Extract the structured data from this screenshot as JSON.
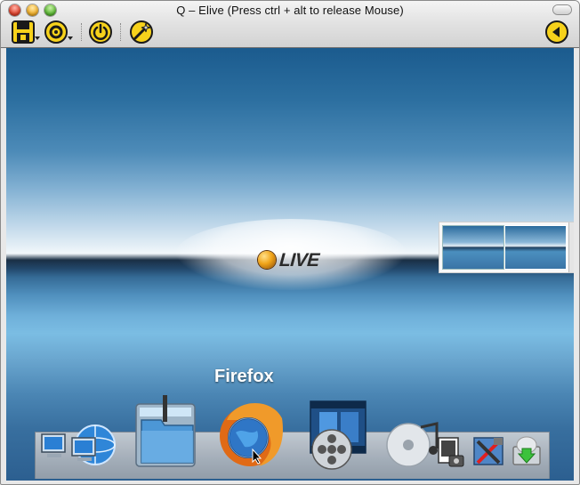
{
  "window": {
    "title": "Q – Elive (Press ctrl + alt to release Mouse)"
  },
  "toolbar": {
    "items": [
      {
        "name": "save-state",
        "icon": "floppy-disk-icon",
        "has_menu": true
      },
      {
        "name": "cd-drive",
        "icon": "cd-icon",
        "has_menu": true
      },
      {
        "name": "power",
        "icon": "power-icon",
        "has_menu": false
      },
      {
        "name": "screenshot",
        "icon": "magic-wand-icon",
        "has_menu": false
      },
      {
        "name": "back",
        "icon": "back-arrow-icon",
        "has_menu": false
      }
    ],
    "accent": "#f7d21b"
  },
  "desktop": {
    "logo_text": "LIVE",
    "dock": {
      "hover_label": "Firefox",
      "items": [
        {
          "name": "network-computers",
          "icon": "network-icon"
        },
        {
          "name": "file-manager",
          "icon": "folder-icon"
        },
        {
          "name": "firefox",
          "icon": "firefox-icon"
        },
        {
          "name": "video-player",
          "icon": "film-reel-icon"
        },
        {
          "name": "media",
          "icon": "music-photo-icon"
        },
        {
          "name": "tools",
          "icon": "tools-icon"
        },
        {
          "name": "installer",
          "icon": "install-drive-icon"
        }
      ]
    }
  }
}
